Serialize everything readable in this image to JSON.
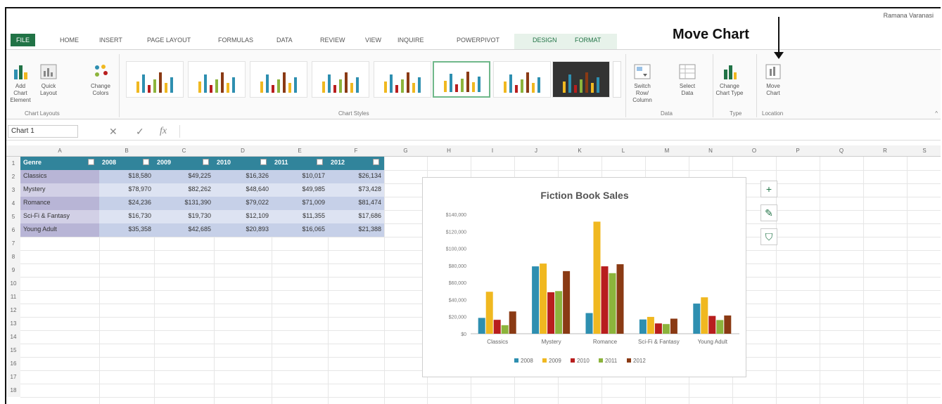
{
  "callout": "Move Chart",
  "tabs": [
    {
      "label": "FILE",
      "kind": "file"
    },
    {
      "label": "HOME",
      "kind": "normal"
    },
    {
      "label": "INSERT",
      "kind": "normal"
    },
    {
      "label": "PAGE LAYOUT",
      "kind": "normal"
    },
    {
      "label": "FORMULAS",
      "kind": "normal"
    },
    {
      "label": "DATA",
      "kind": "normal"
    },
    {
      "label": "REVIEW",
      "kind": "normal"
    },
    {
      "label": "VIEW",
      "kind": "normal"
    },
    {
      "label": "INQUIRE",
      "kind": "normal"
    },
    {
      "label": "POWERPIVOT",
      "kind": "normal"
    },
    {
      "label": "DESIGN",
      "kind": "ctx"
    },
    {
      "label": "FORMAT",
      "kind": "ctx"
    }
  ],
  "user": "Ramana Varanasi",
  "ribbon": {
    "add_chart_element": "Add Chart Element",
    "quick_layout": "Quick Layout",
    "change_colors": "Change Colors",
    "chart_layouts_label": "Chart Layouts",
    "chart_styles_label": "Chart Styles",
    "switch_row_column": "Switch Row/ Column",
    "select_data": "Select Data",
    "data_label": "Data",
    "change_chart_type": "Change Chart Type",
    "type_label": "Type",
    "move_chart": "Move Chart",
    "location_label": "Location"
  },
  "formula_bar": {
    "name_box": "Chart 1",
    "fx": "fx",
    "cancel_icon": "x-icon",
    "enter_icon": "check-icon"
  },
  "columns": [
    "A",
    "B",
    "C",
    "D",
    "E",
    "F",
    "G",
    "H",
    "I",
    "J",
    "K",
    "L",
    "M",
    "N",
    "O",
    "P",
    "Q",
    "R",
    "S"
  ],
  "rows": [
    "1",
    "2",
    "3",
    "4",
    "5",
    "6",
    "7",
    "8",
    "9",
    "10",
    "11",
    "12",
    "13",
    "14",
    "15",
    "16",
    "17",
    "18"
  ],
  "table": {
    "headers": [
      "Genre",
      "2008",
      "2009",
      "2010",
      "2011",
      "2012"
    ],
    "rows": [
      [
        "Classics",
        "$18,580",
        "$49,225",
        "$16,326",
        "$10,017",
        "$26,134"
      ],
      [
        "Mystery",
        "$78,970",
        "$82,262",
        "$48,640",
        "$49,985",
        "$73,428"
      ],
      [
        "Romance",
        "$24,236",
        "$131,390",
        "$79,022",
        "$71,009",
        "$81,474"
      ],
      [
        "Sci-Fi & Fantasy",
        "$16,730",
        "$19,730",
        "$12,109",
        "$11,355",
        "$17,686"
      ],
      [
        "Young Adult",
        "$35,358",
        "$42,685",
        "$20,893",
        "$16,065",
        "$21,388"
      ]
    ]
  },
  "chart_data": {
    "type": "bar",
    "title": "Fiction Book Sales",
    "categories": [
      "Classics",
      "Mystery",
      "Romance",
      "Sci-Fi & Fantasy",
      "Young Adult"
    ],
    "series": [
      {
        "name": "2008",
        "color": "#2e8fb0",
        "values": [
          18580,
          78970,
          24236,
          16730,
          35358
        ]
      },
      {
        "name": "2009",
        "color": "#f0b820",
        "values": [
          49225,
          82262,
          131390,
          19730,
          42685
        ]
      },
      {
        "name": "2010",
        "color": "#b81e1e",
        "values": [
          16326,
          48640,
          79022,
          12109,
          20893
        ]
      },
      {
        "name": "2011",
        "color": "#8cb43c",
        "values": [
          10017,
          49985,
          71009,
          11355,
          16065
        ]
      },
      {
        "name": "2012",
        "color": "#8a3a14",
        "values": [
          26134,
          73428,
          81474,
          17686,
          21388
        ]
      }
    ],
    "ylim": [
      0,
      140000
    ],
    "yticks": [
      "$0",
      "$20,000",
      "$40,000",
      "$60,000",
      "$80,000",
      "$100,000",
      "$120,000",
      "$140,000"
    ],
    "grid": false,
    "legend": "bottom"
  },
  "side_buttons": [
    {
      "icon": "plus-icon",
      "glyph": "+"
    },
    {
      "icon": "brush-icon",
      "glyph": "✎"
    },
    {
      "icon": "filter-icon",
      "glyph": "⛉"
    }
  ]
}
